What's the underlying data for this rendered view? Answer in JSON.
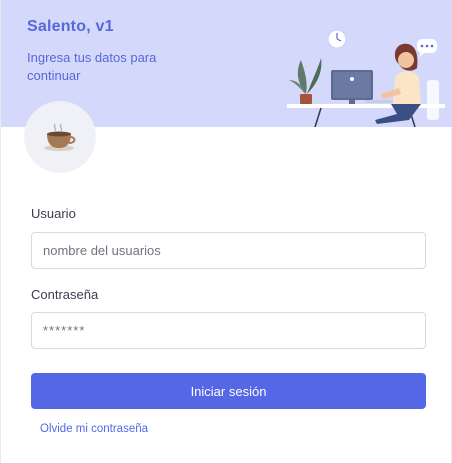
{
  "header": {
    "title": "Salento, v1",
    "subtitle": "Ingresa tus datos para continuar"
  },
  "avatar": {
    "icon": "coffee-cup-icon"
  },
  "form": {
    "username_label": "Usuario",
    "username_placeholder": "nombre del usuarios",
    "password_label": "Contraseña",
    "password_value": "*******",
    "submit_label": "Iniciar sesión",
    "forgot_label": "Olvide mi contraseña"
  },
  "colors": {
    "hero_bg": "#d4d8fa",
    "accent": "#5468e6",
    "title_text": "#5868d8"
  }
}
